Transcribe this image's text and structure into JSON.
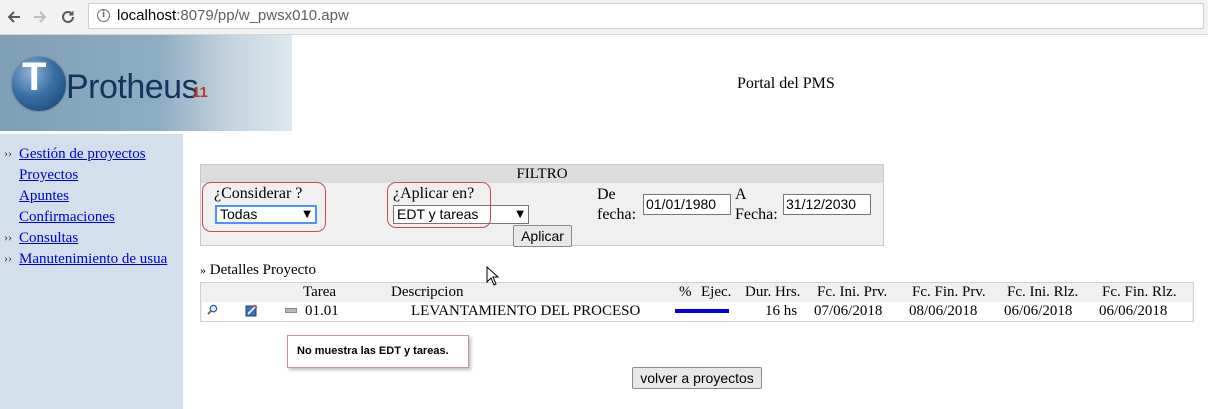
{
  "browser": {
    "url_host": "localhost",
    "url_rest": ":8079/pp/w_pwsx010.apw",
    "back_icon": "arrow-left-icon",
    "forward_icon": "arrow-right-icon",
    "reload_icon": "reload-icon",
    "info_icon": "info-icon"
  },
  "header": {
    "logo_letter": "T",
    "logo_text": "Protheus",
    "logo_version": "11",
    "portal_title": "Portal del PMS"
  },
  "sidebar": {
    "items": [
      {
        "label": "Gestión de proyectos",
        "bullet": "››"
      },
      {
        "label": "Proyectos",
        "bullet": ""
      },
      {
        "label": "Apuntes",
        "bullet": ""
      },
      {
        "label": "Confirmaciones",
        "bullet": ""
      },
      {
        "label": "Consultas",
        "bullet": "››"
      },
      {
        "label": "Manutenimiento de usua",
        "bullet": "››"
      }
    ]
  },
  "filter": {
    "title": "FILTRO",
    "considerar_label": "¿Considerar ?",
    "considerar_value": "Todas",
    "aplicar_label": "¿Aplicar en?",
    "aplicar_value": "EDT y tareas",
    "de_fecha_label_1": "De",
    "de_fecha_label_2": "fecha:",
    "de_fecha_value": "01/01/1980",
    "a_fecha_label_1": "A",
    "a_fecha_label_2": "Fecha:",
    "a_fecha_value": "31/12/2030",
    "aplicar_button": "Aplicar",
    "caret": "▼"
  },
  "details": {
    "bullet": "»",
    "title": "Detalles Proyecto",
    "columns": [
      "Tarea",
      "Descripcion",
      "%",
      "Ejec.",
      "Dur. Hrs.",
      "Fc. Ini. Prv.",
      "Fc. Fin. Prv.",
      "Fc. Ini. Rlz.",
      "Fc. Fin. Rlz."
    ],
    "rows": [
      {
        "tarea": "01.01",
        "descripcion": "LEVANTAMIENTO DEL PROCESO",
        "ejec_progress": 1.0,
        "dur_hrs": "16 hs",
        "fc_ini_prv": "07/06/2018",
        "fc_fin_prv": "08/06/2018",
        "fc_ini_rlz": "06/06/2018",
        "fc_fin_rlz": "06/06/2018"
      }
    ]
  },
  "annotation": {
    "text": "No muestra las EDT y tareas."
  },
  "volver_button": "volver a proyectos",
  "colors": {
    "link": "#0000cc",
    "sidebar_bg": "#d3dfea",
    "progress": "#0000ee",
    "highlight_ring": "#c0504d",
    "callout_border": "#c58cb8"
  }
}
